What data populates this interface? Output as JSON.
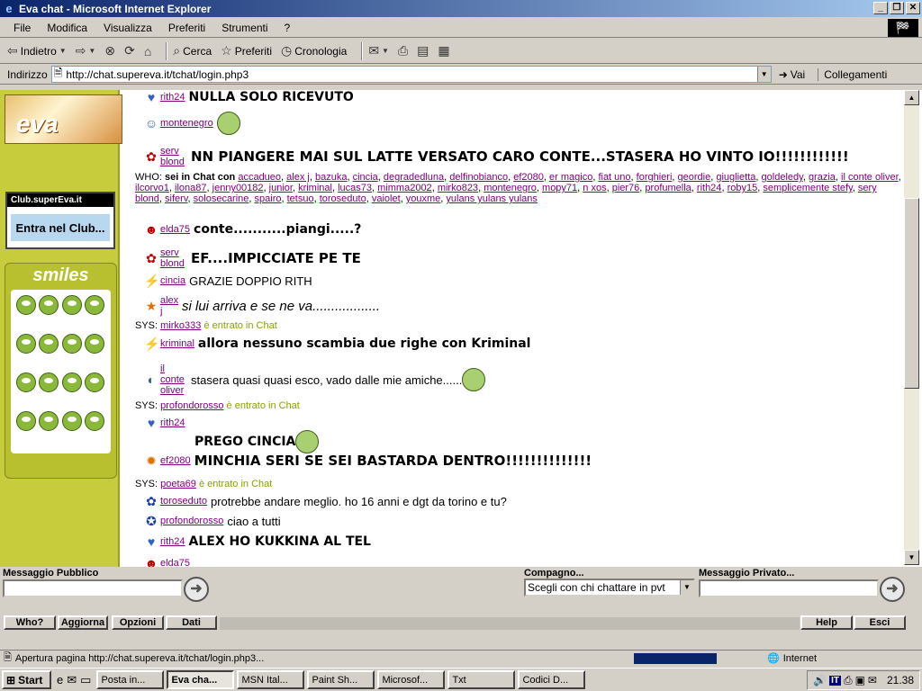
{
  "window": {
    "title": "Eva chat - Microsoft Internet Explorer"
  },
  "menubar": [
    "File",
    "Modifica",
    "Visualizza",
    "Preferiti",
    "Strumenti",
    "?"
  ],
  "toolbar": {
    "back": "Indietro",
    "search": "Cerca",
    "favorites": "Preferiti",
    "history": "Cronologia"
  },
  "address": {
    "label": "Indirizzo",
    "url": "http://chat.supereva.it/tchat/login.php3",
    "go": "Vai",
    "links": "Collegamenti"
  },
  "sidebar": {
    "logo": "eva",
    "club_title": "Club.superEva.it",
    "club_cta": "Entra nel Club...",
    "smiles": "smiles"
  },
  "chat": {
    "m1": {
      "nick": "rith24",
      "text": "NULLA SOLO RICEVUTO"
    },
    "m2": {
      "nick": "montenegro"
    },
    "m3": {
      "nick": "serv blond",
      "text": "NN PIANGERE MAI SUL LATTE VERSATO CARO CONTE...STASERA HO VINTO IO!!!!!!!!!!!!"
    },
    "who_prefix": "WHO:",
    "who_label": "sei in Chat con",
    "who_list": [
      "accadueo",
      "alex j",
      "bazuka",
      "cincia",
      "degradedluna",
      "delfinobianco",
      "ef2080",
      "er magico",
      "fiat uno",
      "forghieri",
      "geordie",
      "giuglietta",
      "goldeledy",
      "grazia",
      "il conte oliver",
      "ilcorvo1",
      "ilona87",
      "jenny00182",
      "junior",
      "kriminal",
      "lucas73",
      "mimma2002",
      "mirko823",
      "montenegro",
      "mopy71",
      "n xos",
      "pier76",
      "profumella",
      "rith24",
      "roby15",
      "semplicemente stefy",
      "sery blond",
      "siferv",
      "solosecarine",
      "spairo",
      "tetsuo",
      "toroseduto",
      "vaiolet",
      "youxme",
      "yulans yulans yulans"
    ],
    "m4": {
      "nick": "elda75",
      "text": "conte...........piangi.....?"
    },
    "m5": {
      "nick": "serv blond",
      "text": "EF....IMPICCIATE PE TE"
    },
    "m6": {
      "nick": "cincia",
      "text": "GRAZIE DOPPIO RITH"
    },
    "m7": {
      "nick": "alex j",
      "text": "si lui arriva e se ne va.................."
    },
    "s1": {
      "prefix": "SYS:",
      "nick": "mirko333",
      "text": "è entrato in Chat"
    },
    "m8": {
      "nick": "kriminal",
      "text": "allora nessuno scambia due righe con Kriminal"
    },
    "m9": {
      "nick": "il conte oliver",
      "text": "stasera quasi quasi esco, vado dalle mie amiche......"
    },
    "s2": {
      "prefix": "SYS:",
      "nick": "profondorosso",
      "text": "è entrato in Chat"
    },
    "m10": {
      "nick": "rith24",
      "text": "PREGO CINCIA"
    },
    "m11": {
      "nick": "ef2080",
      "text": "MINCHIA SERI SE SEI BASTARDA DENTRO!!!!!!!!!!!!!!"
    },
    "s3": {
      "prefix": "SYS:",
      "nick": "poeta69",
      "text": "è entrato in Chat"
    },
    "m12": {
      "nick": "toroseduto",
      "text": "protrebbe andare meglio. ho 16 anni e dgt da torino e tu?"
    },
    "m13": {
      "nick": "profondorosso",
      "text": "ciao a tutti"
    },
    "m14": {
      "nick": "rith24",
      "text": "ALEX HO KUKKINA AL TEL"
    },
    "m15": {
      "nick": "elda75",
      "text": ""
    }
  },
  "form": {
    "public_label": "Messaggio Pubblico",
    "partner_label": "Compagno...",
    "partner_select": "Scegli con chi chattare in pvt",
    "private_label": "Messaggio Privato..."
  },
  "buttons": {
    "who": "Who?",
    "refresh": "Aggiorna",
    "options": "Opzioni",
    "data": "Dati",
    "help": "Help",
    "exit": "Esci"
  },
  "status": {
    "text": "Apertura pagina http://chat.supereva.it/tchat/login.php3...",
    "zone": "Internet"
  },
  "taskbar": {
    "start": "Start",
    "tasks": [
      "Posta in...",
      "Eva cha...",
      "MSN Ital...",
      "Paint Sh...",
      "Microsof...",
      "Txt",
      "Codici D..."
    ],
    "lang": "IT",
    "time": "21.38"
  }
}
